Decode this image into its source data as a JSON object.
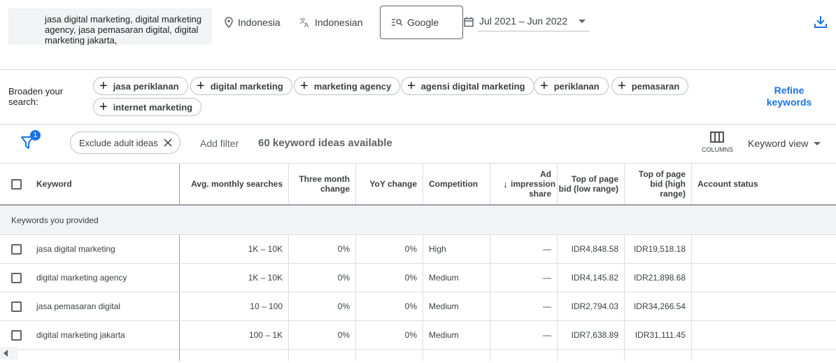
{
  "top": {
    "keywords": "jasa digital marketing, digital marketing agency, jasa pemasaran digital, digital marketing jakarta,",
    "location": "Indonesia",
    "language": "Indonesian",
    "network": "Google",
    "date_range": "Jul 2021 – Jun 2022"
  },
  "broaden": {
    "label": "Broaden your search:",
    "chips": [
      "jasa periklanan",
      "digital marketing",
      "marketing agency",
      "agensi digital marketing",
      "periklanan",
      "pemasaran",
      "internet marketing"
    ],
    "refine": "Refine keywords"
  },
  "filterbar": {
    "badge": "1",
    "exclude_chip": "Exclude adult ideas",
    "add_filter": "Add filter",
    "ideas_count": "60 keyword ideas available",
    "columns_label": "COLUMNS",
    "view_label": "Keyword view"
  },
  "table": {
    "headers": {
      "keyword": "Keyword",
      "avg": "Avg. monthly searches",
      "three_month": "Three month change",
      "yoy": "YoY change",
      "competition": "Competition",
      "ad_impression": "Ad impression share",
      "bid_low": "Top of page bid (low range)",
      "bid_high": "Top of page bid (high range)",
      "account_status": "Account status"
    },
    "group_label": "Keywords you provided",
    "rows": [
      {
        "keyword": "jasa digital marketing",
        "avg": "1K – 10K",
        "three": "0%",
        "yoy": "0%",
        "comp": "High",
        "ad": "—",
        "low": "IDR4,848.58",
        "high": "IDR19,518.18"
      },
      {
        "keyword": "digital marketing agency",
        "avg": "1K – 10K",
        "three": "0%",
        "yoy": "0%",
        "comp": "Medium",
        "ad": "—",
        "low": "IDR4,145.82",
        "high": "IDR21,898.68"
      },
      {
        "keyword": "jasa pemasaran digital",
        "avg": "10 – 100",
        "three": "0%",
        "yoy": "0%",
        "comp": "Medium",
        "ad": "—",
        "low": "IDR2,794.03",
        "high": "IDR34,266.54"
      },
      {
        "keyword": "digital marketing jakarta",
        "avg": "100 – 1K",
        "three": "0%",
        "yoy": "0%",
        "comp": "Medium",
        "ad": "—",
        "low": "IDR7,638.89",
        "high": "IDR31,111.45"
      }
    ]
  },
  "colors": {
    "accent": "#1a73e8",
    "chip_border": "#bdc1c6",
    "group_bg": "#f1f3f4"
  }
}
